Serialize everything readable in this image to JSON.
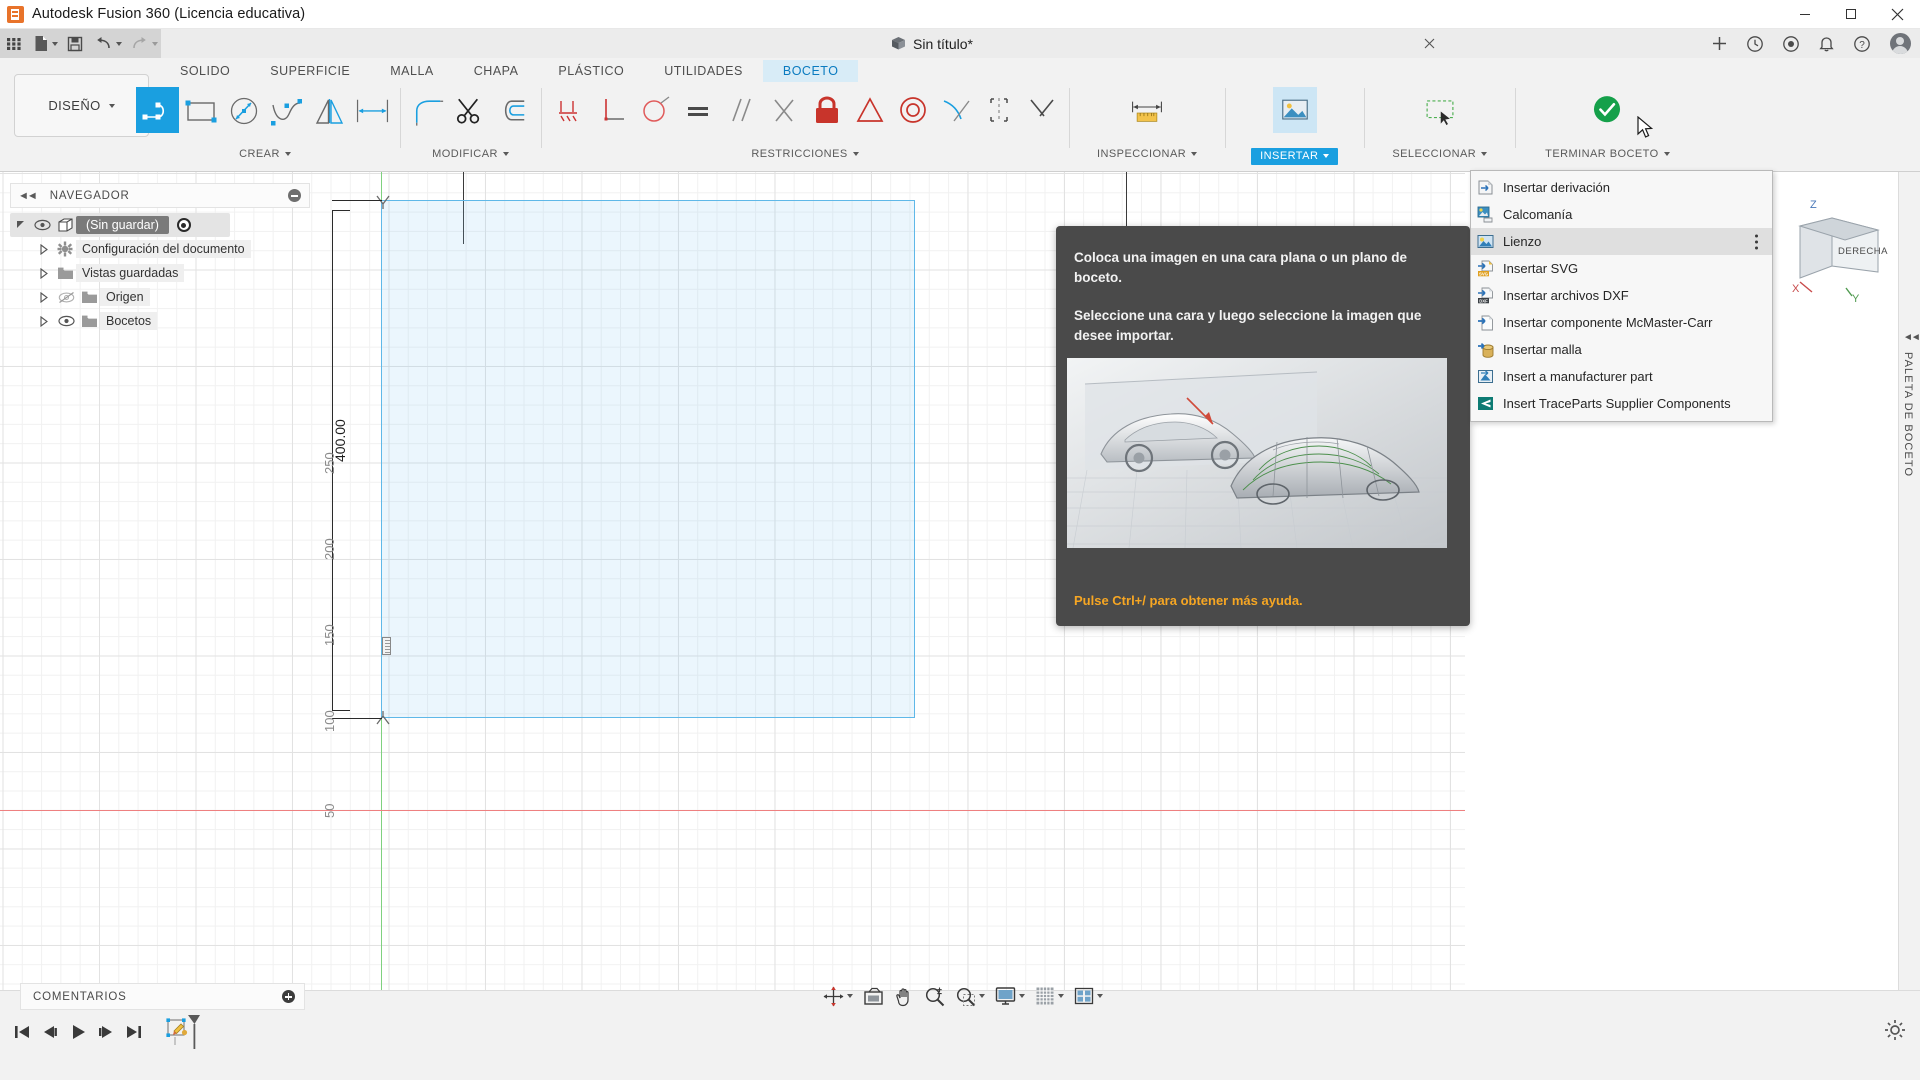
{
  "window": {
    "title": "Autodesk Fusion 360 (Licencia educativa)",
    "app_icon": "fusion-logo-icon",
    "minimize": "minimize-icon",
    "maximize": "maximize-icon",
    "close": "close-icon"
  },
  "quick_access": {
    "grid_menu": "app-grid-icon",
    "new_file": "new-file-icon",
    "save": "save-icon",
    "undo": "undo-icon",
    "redo": "redo-icon",
    "document_title": "Sin título*",
    "document_modified": true,
    "tab_close": "close-icon",
    "add_tab": "plus-icon",
    "job_status": "clock-status-icon",
    "notifications_help": "help-circle-icon",
    "notifications": "bell-icon",
    "help": "question-circle-icon",
    "account": "user-avatar-icon"
  },
  "workspace": {
    "label": "DISEÑO"
  },
  "tabs": [
    {
      "label": "SOLIDO",
      "active": false
    },
    {
      "label": "SUPERFICIE",
      "active": false
    },
    {
      "label": "MALLA",
      "active": false
    },
    {
      "label": "CHAPA",
      "active": false
    },
    {
      "label": "PLÁSTICO",
      "active": false
    },
    {
      "label": "UTILIDADES",
      "active": false
    },
    {
      "label": "BOCETO",
      "active": true
    }
  ],
  "ribbon_panels": [
    {
      "label": "CREAR",
      "has_caret": true,
      "highlight": false,
      "tools": [
        {
          "name": "sketch-line-tool",
          "selected": true
        },
        {
          "name": "sketch-rectangle-tool",
          "selected": false
        },
        {
          "name": "sketch-circle-tool",
          "selected": false
        },
        {
          "name": "sketch-spline-tool",
          "selected": false
        },
        {
          "name": "sketch-mirror-tool",
          "selected": false
        },
        {
          "name": "sketch-dimension-tool",
          "selected": false
        }
      ]
    },
    {
      "label": "MODIFICAR",
      "has_caret": true,
      "highlight": false,
      "tools": [
        {
          "name": "sketch-fillet-tool",
          "selected": false
        },
        {
          "name": "sketch-trim-tool",
          "selected": false
        },
        {
          "name": "sketch-offset-tool",
          "selected": false
        }
      ]
    },
    {
      "label": "RESTRICCIONES",
      "has_caret": true,
      "highlight": false,
      "tools": [
        {
          "name": "constraint-fix-ground-tool",
          "selected": false
        },
        {
          "name": "constraint-perpendicular-tool",
          "selected": false
        },
        {
          "name": "constraint-curvature-tool",
          "selected": false
        },
        {
          "name": "constraint-equal-tool",
          "selected": false
        },
        {
          "name": "constraint-parallel-tool",
          "selected": false
        },
        {
          "name": "constraint-tangent-tool",
          "selected": false
        },
        {
          "name": "constraint-lock-tool",
          "selected": false
        },
        {
          "name": "constraint-midpoint-tool",
          "selected": false
        },
        {
          "name": "constraint-concentric-tool",
          "selected": false
        },
        {
          "name": "constraint-coincident-tool",
          "selected": false
        },
        {
          "name": "constraint-symmetry-tool",
          "selected": false
        },
        {
          "name": "constraint-collinear-tool",
          "selected": false
        }
      ]
    },
    {
      "label": "INSPECCIONAR",
      "has_caret": true,
      "highlight": false,
      "tools": [
        {
          "name": "measure-tool",
          "selected": false
        }
      ]
    },
    {
      "label": "INSERTAR",
      "has_caret": true,
      "highlight": true,
      "tools": [
        {
          "name": "insert-canvas-tool",
          "selected": false
        }
      ]
    },
    {
      "label": "SELECCIONAR",
      "has_caret": true,
      "highlight": false,
      "tools": [
        {
          "name": "select-window-tool",
          "selected": false
        }
      ]
    },
    {
      "label": "TERMINAR BOCETO",
      "has_caret": true,
      "highlight": false,
      "tools": [
        {
          "name": "finish-sketch-tool",
          "selected": false
        }
      ]
    }
  ],
  "navigator": {
    "panel_title": "NAVEGADOR",
    "collapse_icon": "collapse-left-icon",
    "options_icon": "panel-options-icon",
    "tree": [
      {
        "label": "(Sin guardar)",
        "expanded": true,
        "selected": true,
        "visible": true,
        "icon": "component-cube-icon",
        "has_radio": true,
        "indent": 0
      },
      {
        "label": "Configuración del documento",
        "expanded": false,
        "selected": false,
        "visible": null,
        "icon": "gear-icon",
        "has_radio": false,
        "indent": 1
      },
      {
        "label": "Vistas guardadas",
        "expanded": false,
        "selected": false,
        "visible": null,
        "icon": "folder-icon",
        "has_radio": false,
        "indent": 1
      },
      {
        "label": "Origen",
        "expanded": false,
        "selected": false,
        "visible": false,
        "icon": "folder-icon",
        "has_radio": false,
        "indent": 1
      },
      {
        "label": "Bocetos",
        "expanded": false,
        "selected": false,
        "visible": true,
        "icon": "folder-icon",
        "has_radio": false,
        "indent": 1
      }
    ]
  },
  "insert_menu": {
    "items": [
      {
        "label": "Insertar derivación",
        "icon": "insert-derive-icon",
        "hover": false,
        "has_overflow": false
      },
      {
        "label": "Calcomanía",
        "icon": "decal-icon",
        "hover": false,
        "has_overflow": false
      },
      {
        "label": "Lienzo",
        "icon": "canvas-image-icon",
        "hover": true,
        "has_overflow": true
      },
      {
        "label": "Insertar SVG",
        "icon": "svg-file-icon",
        "hover": false,
        "has_overflow": false
      },
      {
        "label": "Insertar archivos DXF",
        "icon": "dxf-file-icon",
        "hover": false,
        "has_overflow": false
      },
      {
        "label": "Insertar componente McMaster-Carr",
        "icon": "mcmaster-part-icon",
        "hover": false,
        "has_overflow": false
      },
      {
        "label": "Insertar malla",
        "icon": "mesh-insert-icon",
        "hover": false,
        "has_overflow": false
      },
      {
        "label": "Insert a manufacturer part",
        "icon": "manufacturer-part-icon",
        "hover": false,
        "has_overflow": false
      },
      {
        "label": "Insert TraceParts Supplier Components",
        "icon": "traceparts-icon",
        "hover": false,
        "has_overflow": false
      }
    ]
  },
  "tooltip": {
    "line1": "Coloca una imagen en una cara plana o un plano de boceto.",
    "line2": "Seleccione una cara y luego seleccione la imagen que desee importar.",
    "footer": "Pulse Ctrl+/ para obtener más ayuda.",
    "preview_alt": "canvas-image-preview"
  },
  "canvas": {
    "dimension_value": "400.00",
    "ruler_ticks": [
      "250",
      "200",
      "150",
      "100",
      "50"
    ],
    "sketch_profile": "rectangle-sketch-region",
    "axis_y_color": "#7fd17f",
    "axis_x_color": "#ee8080",
    "sketch_color": "#5fb8e8"
  },
  "view_cube": {
    "face_label": "DERECHA",
    "axis_z": "Z",
    "axis_y": "Y",
    "axis_x": "X"
  },
  "right_palette": {
    "label": "PALETA DE BOCETO",
    "collapse_icon": "collapse-right-icon"
  },
  "nav_toolbar": [
    {
      "name": "orbit-tool",
      "has_caret": true
    },
    {
      "name": "look-at-tool",
      "has_caret": false
    },
    {
      "name": "pan-tool",
      "has_caret": false
    },
    {
      "name": "zoom-tool",
      "has_caret": false
    },
    {
      "name": "zoom-window-tool",
      "has_caret": true
    },
    {
      "name": "display-settings-tool",
      "has_caret": true
    },
    {
      "name": "grid-snap-tool",
      "has_caret": true
    },
    {
      "name": "viewports-tool",
      "has_caret": true
    }
  ],
  "comments": {
    "label": "COMENTARIOS",
    "add_icon": "add-comment-icon"
  },
  "timeline": {
    "controls": [
      {
        "name": "timeline-jump-start-button"
      },
      {
        "name": "timeline-step-back-button"
      },
      {
        "name": "timeline-play-button"
      },
      {
        "name": "timeline-step-forward-button"
      },
      {
        "name": "timeline-jump-end-button"
      }
    ],
    "features": [
      {
        "name": "timeline-sketch-feature",
        "label": ""
      }
    ],
    "settings_icon": "gear-icon"
  },
  "colors": {
    "accent_blue": "#1a9fe0",
    "tab_active_bg": "#d8ecf7",
    "tab_active_text": "#0a7bc0",
    "ribbon_bg": "#f2f2f2",
    "qab_bg": "#d4d4d4",
    "tooltip_bg": "#4a4a4a",
    "tooltip_footer": "#f6a623",
    "finish_green": "#15a04a"
  }
}
